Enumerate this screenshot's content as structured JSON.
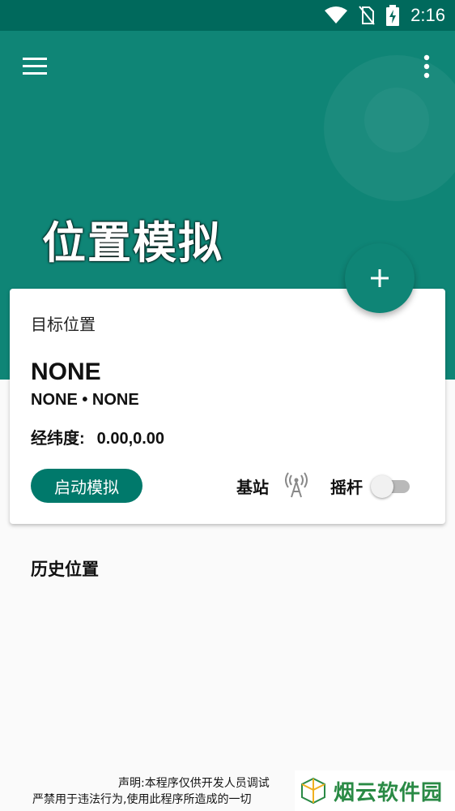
{
  "status_bar": {
    "time": "2:16",
    "icons": [
      "wifi-icon",
      "no-sim-icon",
      "battery-charging-icon"
    ]
  },
  "app_bar": {
    "menu_icon": "menu-icon",
    "more_icon": "more-vert-icon"
  },
  "page": {
    "title": "位置模拟"
  },
  "fab": {
    "icon": "plus-icon"
  },
  "target_card": {
    "label": "目标位置",
    "place_name": "NONE",
    "place_detail": "NONE • NONE",
    "coord_label": "经纬度:",
    "coord_value": "0.00,0.00",
    "start_button": "启动模拟",
    "base_station_label": "基站",
    "base_station_icon": "antenna-icon",
    "joystick_label": "摇杆",
    "joystick_enabled": false
  },
  "history": {
    "title": "历史位置"
  },
  "footer": {
    "disclaimer_line1": "声明:本程序仅供开发人员调试",
    "disclaimer_line2": "严禁用于违法行为,使用此程序所造成的一切"
  },
  "watermark": {
    "text": "烟云软件园"
  },
  "colors": {
    "primary": "#0f8576",
    "primary_dark": "#00695c",
    "accent_button": "#00796b"
  }
}
